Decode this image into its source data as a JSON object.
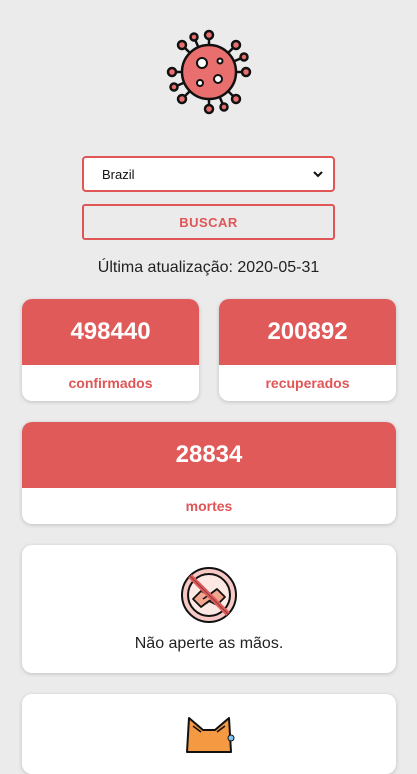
{
  "country_select": {
    "value": "Brazil"
  },
  "search_button": {
    "label": "BUSCAR"
  },
  "last_update": {
    "label": "Última atualização:",
    "date": "2020-05-31"
  },
  "stats": {
    "confirmed": {
      "value": "498440",
      "label": "confirmados"
    },
    "recovered": {
      "value": "200892",
      "label": "recuperados"
    },
    "deaths": {
      "value": "28834",
      "label": "mortes"
    }
  },
  "tips": [
    {
      "text": "Não aperte as mãos.",
      "icon": "no-handshake-icon"
    },
    {
      "icon": "sick-cat-icon"
    }
  ],
  "colors": {
    "accent": "#e05a5a",
    "background": "#ebebeb",
    "card": "#ffffff"
  }
}
